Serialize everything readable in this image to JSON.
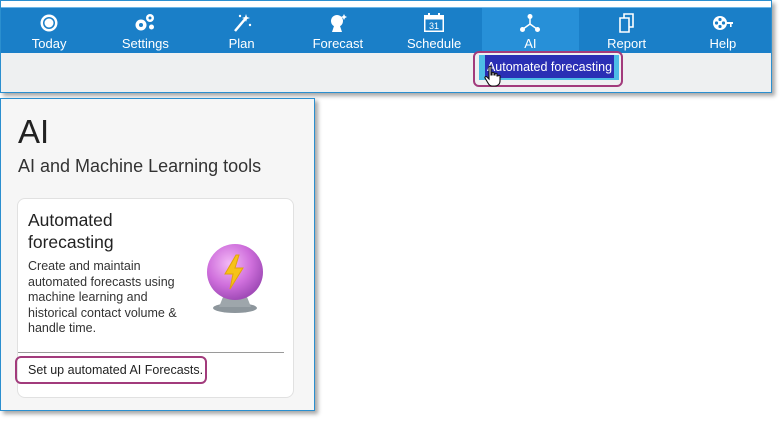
{
  "nav": {
    "items": [
      {
        "label": "Today",
        "icon": "sun-icon"
      },
      {
        "label": "Settings",
        "icon": "gears-icon"
      },
      {
        "label": "Plan",
        "icon": "magic-wand-icon"
      },
      {
        "label": "Forecast",
        "icon": "fortune-teller-icon"
      },
      {
        "label": "Schedule",
        "icon": "calendar-icon"
      },
      {
        "label": "AI",
        "icon": "network-nodes-icon"
      },
      {
        "label": "Report",
        "icon": "documents-icon"
      },
      {
        "label": "Help",
        "icon": "film-reel-key-icon"
      }
    ],
    "active_index": 5,
    "calendar_day": "31"
  },
  "submenu": {
    "item_label": "Automated forecasting"
  },
  "ai_page": {
    "title": "AI",
    "subtitle": "AI and Machine Learning tools",
    "card": {
      "title": "Automated forecasting",
      "description": "Create and maintain automated forecasts using machine learning and historical contact volume & handle time.",
      "link_label": "Set up automated AI Forecasts.",
      "icon": "crystal-ball-icon"
    }
  },
  "colors": {
    "nav_background": "#1a7fc8",
    "nav_active": "#2790d8",
    "submenu_background": "#2a2fb5",
    "submenu_edge": "#4dbde6",
    "highlight_outline": "#a23b7c",
    "window_border": "#2b8fcf"
  }
}
